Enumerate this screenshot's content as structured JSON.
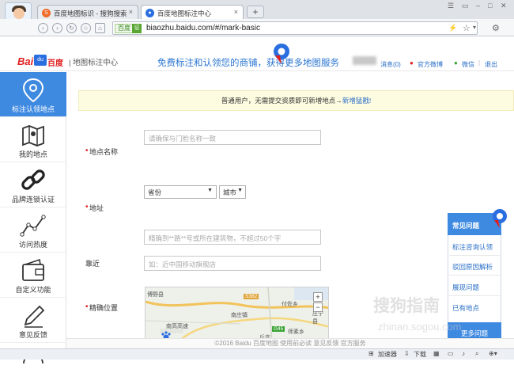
{
  "browser": {
    "tabs": [
      {
        "label": "百度地图标识 - 搜狗搜索",
        "icon": "sogou-icon"
      },
      {
        "label": "百度地图标注中心",
        "icon": "baidu-map-pin-icon"
      }
    ],
    "new_tab": "+",
    "url_badge": "百度",
    "url_secure": "证",
    "url": "biaozhu.baidu.com/#/mark-basic"
  },
  "header": {
    "logo_bai": "Bai",
    "logo_du": "du",
    "logo_baidu": "百度",
    "logo_title": "| 地图标注中心",
    "slogan": "免费标注和认领您的商铺，获得更多地图服务",
    "links": {
      "messages": "消息(0)",
      "weibo": "官方微博",
      "wechat": "微信",
      "logout": "退出"
    }
  },
  "sidebar": {
    "items": [
      {
        "label": "标注认领地点",
        "icon": "location-pin-icon"
      },
      {
        "label": "我的地点",
        "icon": "map-icon"
      },
      {
        "label": "品牌连锁认证",
        "icon": "chain-link-icon"
      },
      {
        "label": "访问热度",
        "icon": "trend-line-icon"
      },
      {
        "label": "自定义功能",
        "icon": "wallet-icon"
      },
      {
        "label": "意见反馈",
        "icon": "pen-icon"
      }
    ]
  },
  "notice": {
    "text": "普通用户，无需提交资质即可新增地点→",
    "link": "新增猛戳!"
  },
  "form": {
    "name_label": "地点名称",
    "name_placeholder": "请确保与门脸名称一致",
    "address_label": "地址",
    "province": "省份",
    "city": "城市",
    "street_placeholder": "精确到**路**号或所在建筑物，不超过50个字",
    "nearby_label": "靠近",
    "nearby_placeholder": "如：近中国移动旗舰店",
    "location_label": "精确位置",
    "map_labels": {
      "county": "博野县",
      "road_s382": "S382",
      "fuqi": "付佐乡",
      "nanzhuang": "南庄镇",
      "g45": "G45",
      "shimenxiang": "师素乡",
      "yongning": "庄宁县",
      "nangao": "南高高速",
      "qiuzhuang": "丘庄"
    },
    "map_zoom_in": "+",
    "map_zoom_out": "−"
  },
  "help_panel": {
    "title": "常见问题",
    "items": [
      "标注咨询认领",
      "驳回原因解析",
      "展现问题",
      "已有地点"
    ],
    "more": "更多问题"
  },
  "footer": {
    "text": "©2016 Baidu  百度地图  使用前必读  意见反馈  官方服务"
  },
  "statusbar": {
    "accelerator": "加速器",
    "download": "下载"
  },
  "watermark": {
    "main": "搜狗指南",
    "sub": "zhinan.sogou.com"
  },
  "colors": {
    "accent": "#3f8ae1",
    "brand_red": "#e01e1e",
    "link": "#2a6fc6",
    "required": "#e02020",
    "notice_bg": "#fdfbe0"
  }
}
